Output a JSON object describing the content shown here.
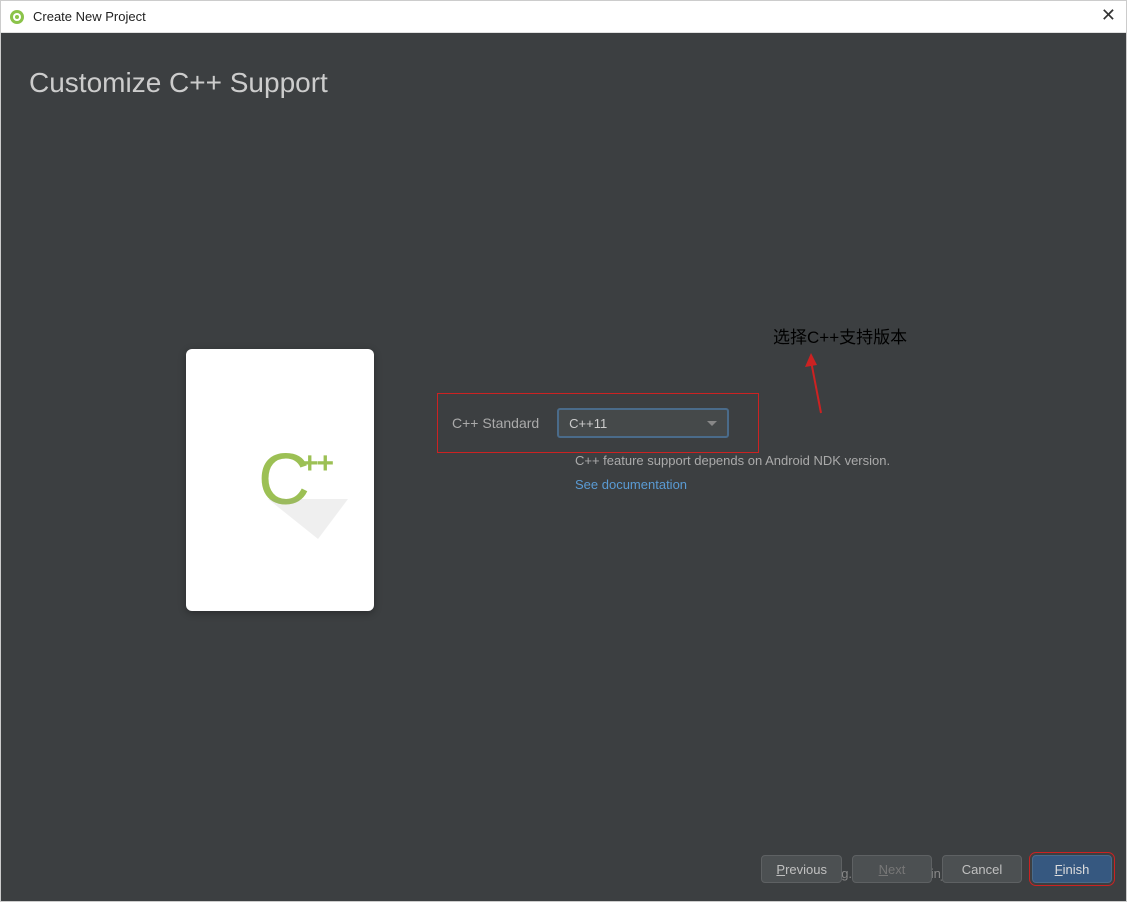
{
  "window": {
    "title": "Create New Project"
  },
  "page": {
    "heading": "Customize C++ Support"
  },
  "form": {
    "label": "C++ Standard",
    "dropdown_value": "C++11",
    "help_text": "C++ feature support depends on Android NDK version.",
    "doc_link": "See documentation"
  },
  "annotation": {
    "text": "选择C++支持版本"
  },
  "buttons": {
    "previous": "Previous",
    "next": "Next",
    "cancel": "Cancel",
    "finish": "Finish"
  },
  "watermark": "https://blog.csdn.net/weixin_42517021"
}
